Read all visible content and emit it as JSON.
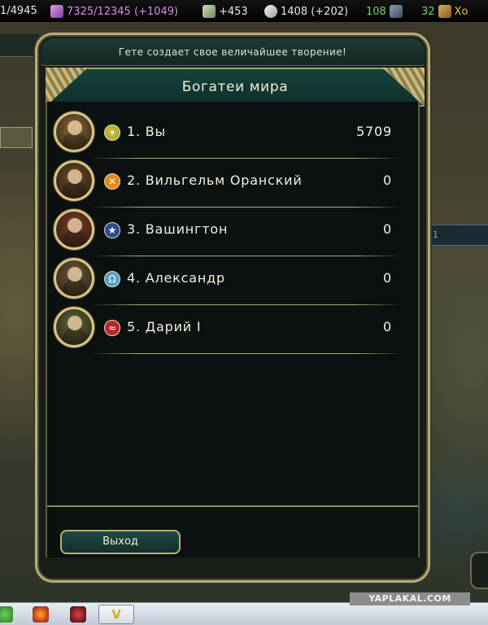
{
  "topbar": {
    "turn_fragment": "1/4945",
    "science": "7325/12345 (+1049)",
    "gold": "+453",
    "faith": "1408 (+202)",
    "culture": "108",
    "tourism": "32",
    "next_label": "Хо"
  },
  "world": {
    "right_tab_text": "1"
  },
  "dialog": {
    "notice": "Гете создает свое величайшее творение!",
    "title": "Богатеи мира",
    "exit_label": "Выход"
  },
  "rankings": [
    {
      "label": "1. Вы",
      "score": "5709",
      "civ_icon": "sun-icon",
      "civ_color": "#b8b030"
    },
    {
      "label": "2. Вильгельм Оранский",
      "score": "0",
      "civ_icon": "netherlands-icon",
      "civ_color": "#e08a20"
    },
    {
      "label": "3. Вашингтон",
      "score": "0",
      "civ_icon": "america-icon",
      "civ_color": "#2f4a8f"
    },
    {
      "label": "4. Александр",
      "score": "0",
      "civ_icon": "greece-icon",
      "civ_color": "#5aa0c8"
    },
    {
      "label": "5. Дарий I",
      "score": "0",
      "civ_icon": "persia-icon",
      "civ_color": "#b8262a"
    }
  ],
  "portrait_colors": [
    "#8a6a3a",
    "#6a4a2a",
    "#7a3a2a",
    "#6a5a3a",
    "#5a6a3a"
  ],
  "watermark": "YAPLAKAL.COM"
}
